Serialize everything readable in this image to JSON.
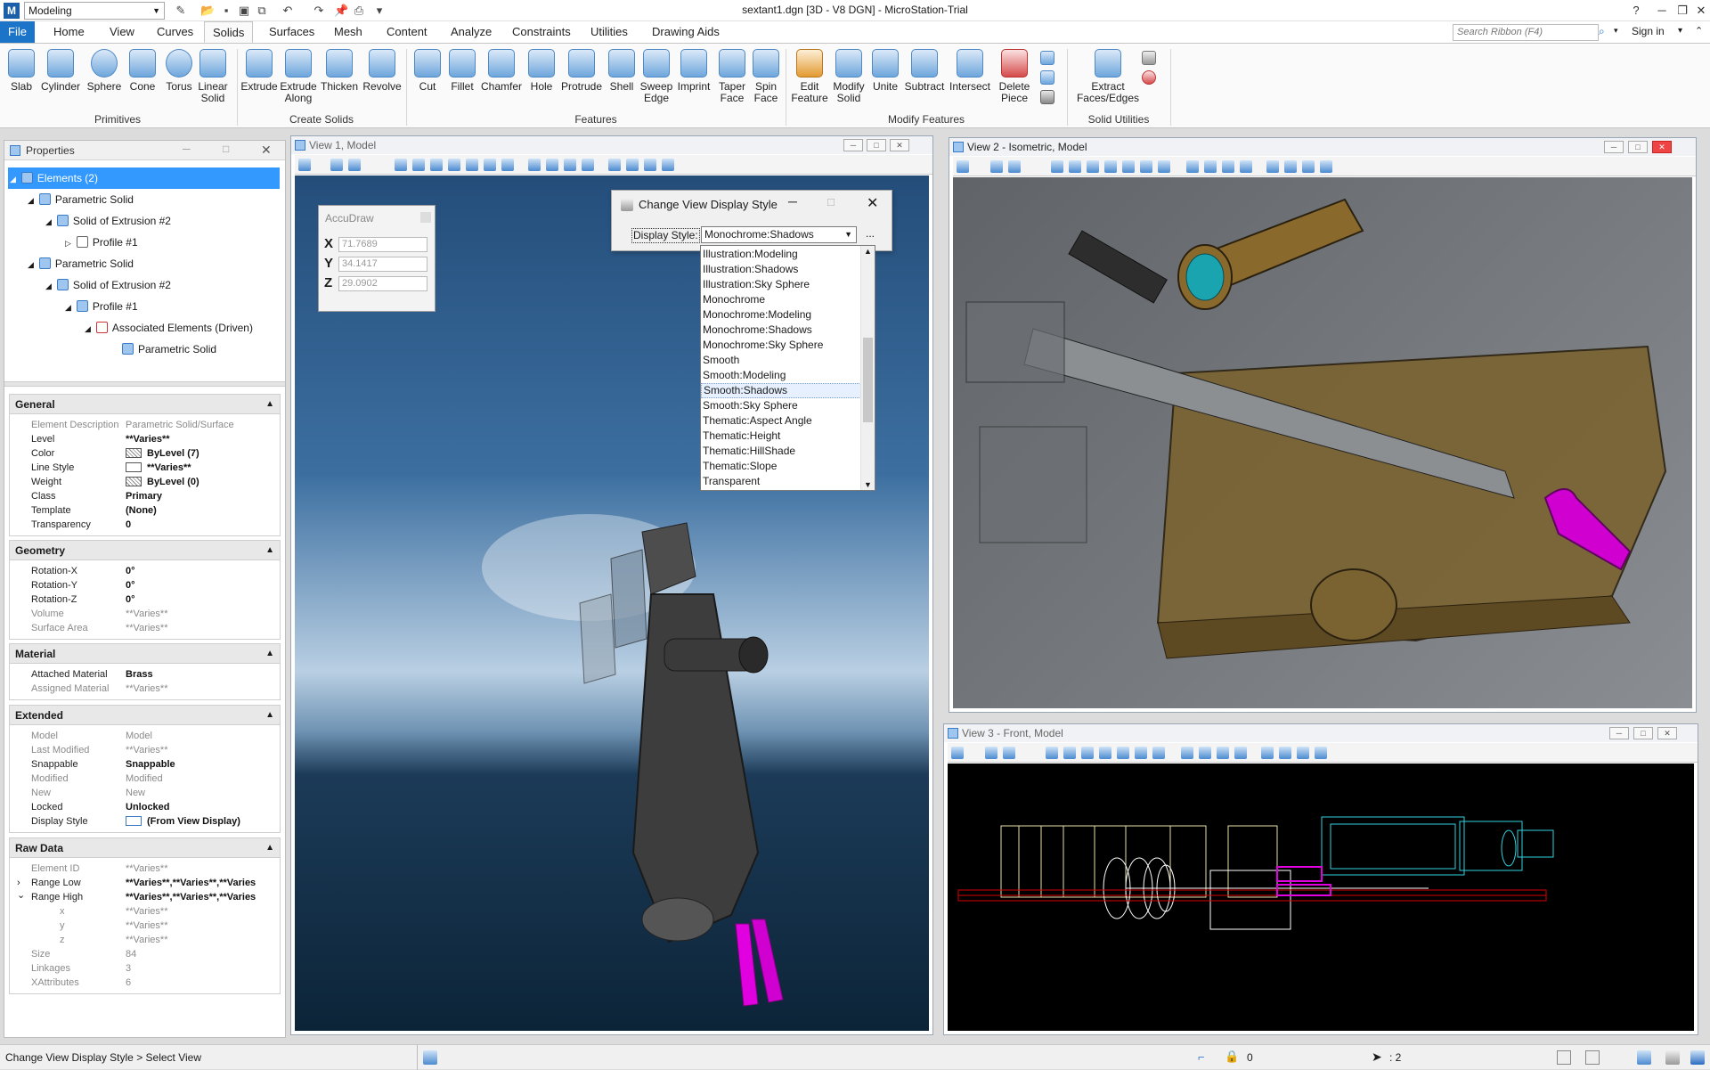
{
  "app": {
    "workflow": "Modeling",
    "window_title": "sextant1.dgn [3D - V8 DGN] - MicroStation-Trial",
    "search_placeholder": "Search Ribbon (F4)",
    "sign_in": "Sign in"
  },
  "tabs": [
    "File",
    "Home",
    "View",
    "Curves",
    "Solids",
    "Surfaces",
    "Mesh",
    "Content",
    "Analyze",
    "Constraints",
    "Utilities",
    "Drawing Aids"
  ],
  "active_tab": "Solids",
  "ribbon": {
    "groups": [
      {
        "label": "Primitives",
        "buttons": [
          "Slab",
          "Cylinder",
          "Sphere",
          "Cone",
          "Torus",
          "Linear Solid"
        ]
      },
      {
        "label": "Create Solids",
        "buttons": [
          "Extrude",
          "Extrude Along",
          "Thicken",
          "Revolve"
        ]
      },
      {
        "label": "Features",
        "buttons": [
          "Cut",
          "Fillet",
          "Chamfer",
          "Hole",
          "Protrude",
          "Shell",
          "Sweep Edge",
          "Imprint",
          "Taper Face",
          "Spin Face"
        ]
      },
      {
        "label": "Modify Features",
        "buttons": [
          "Edit Feature",
          "Modify Solid",
          "Unite",
          "Subtract",
          "Intersect",
          "Delete Piece"
        ]
      },
      {
        "label": "Solid Utilities",
        "buttons": [
          "Extract Faces/Edges"
        ]
      }
    ]
  },
  "properties": {
    "title": "Properties",
    "tree": [
      {
        "label": "Elements (2)",
        "depth": 0,
        "selected": true
      },
      {
        "label": "Parametric Solid",
        "depth": 1
      },
      {
        "label": "Solid of Extrusion #2",
        "depth": 2
      },
      {
        "label": "Profile #1",
        "depth": 3
      },
      {
        "label": "Parametric Solid",
        "depth": 1
      },
      {
        "label": "Solid of Extrusion #2",
        "depth": 2
      },
      {
        "label": "Profile #1",
        "depth": 3
      },
      {
        "label": "Associated Elements (Driven)",
        "depth": 4
      },
      {
        "label": "Parametric Solid",
        "depth": 5
      }
    ],
    "sections": [
      {
        "title": "General",
        "rows": [
          {
            "k": "Element Description",
            "v": "Parametric Solid/Surface",
            "dim": true
          },
          {
            "k": "Level",
            "v": "**Varies**"
          },
          {
            "k": "Color",
            "v": "ByLevel (7)"
          },
          {
            "k": "Line Style",
            "v": "**Varies**"
          },
          {
            "k": "Weight",
            "v": "ByLevel (0)"
          },
          {
            "k": "Class",
            "v": "Primary"
          },
          {
            "k": "Template",
            "v": "(None)"
          },
          {
            "k": "Transparency",
            "v": "0"
          }
        ]
      },
      {
        "title": "Geometry",
        "rows": [
          {
            "k": "Rotation-X",
            "v": "0°"
          },
          {
            "k": "Rotation-Y",
            "v": "0°"
          },
          {
            "k": "Rotation-Z",
            "v": "0°"
          },
          {
            "k": "Volume",
            "v": "**Varies**",
            "dim": true
          },
          {
            "k": "Surface Area",
            "v": "**Varies**",
            "dim": true
          }
        ]
      },
      {
        "title": "Material",
        "rows": [
          {
            "k": "Attached Material",
            "v": "Brass"
          },
          {
            "k": "Assigned Material",
            "v": "**Varies**",
            "dim": true
          }
        ]
      },
      {
        "title": "Extended",
        "rows": [
          {
            "k": "Model",
            "v": "Model",
            "dim": true
          },
          {
            "k": "Last Modified",
            "v": "**Varies**",
            "dim": true
          },
          {
            "k": "Snappable",
            "v": "Snappable"
          },
          {
            "k": "Modified",
            "v": "Modified",
            "dim": true
          },
          {
            "k": "New",
            "v": "New",
            "dim": true
          },
          {
            "k": "Locked",
            "v": "Unlocked"
          },
          {
            "k": "Display Style",
            "v": "(From View Display)"
          }
        ]
      },
      {
        "title": "Raw Data",
        "rows": [
          {
            "k": "Element ID",
            "v": "**Varies**",
            "dim": true
          },
          {
            "k": "Range Low",
            "v": "**Varies**,**Varies**,**Varies",
            "caret": "›"
          },
          {
            "k": "Range High",
            "v": "**Varies**,**Varies**,**Varies",
            "caret": "⌄"
          },
          {
            "k": "x",
            "v": "**Varies**",
            "dim": true,
            "indent": true
          },
          {
            "k": "y",
            "v": "**Varies**",
            "dim": true,
            "indent": true
          },
          {
            "k": "z",
            "v": "**Varies**",
            "dim": true,
            "indent": true
          },
          {
            "k": "Size",
            "v": "84",
            "dim": true
          },
          {
            "k": "Linkages",
            "v": "3",
            "dim": true
          },
          {
            "k": "XAttributes",
            "v": "6",
            "dim": true
          }
        ]
      }
    ]
  },
  "views": {
    "v1": "View 1, Model",
    "v2": "View 2 - Isometric, Model",
    "v3": "View 3 - Front, Model"
  },
  "accudraw": {
    "title": "AccuDraw",
    "x_label": "X",
    "x": "71.7689",
    "y_label": "Y",
    "y": "34.1417",
    "z_label": "Z",
    "z": "29.0902"
  },
  "display_style_dialog": {
    "title": "Change View Display Style",
    "label": "Display Style:",
    "selected": "Monochrome:Shadows",
    "more": "...",
    "options": [
      "Illustration:Modeling",
      "Illustration:Shadows",
      "Illustration:Sky Sphere",
      "Monochrome",
      "Monochrome:Modeling",
      "Monochrome:Shadows",
      "Monochrome:Sky Sphere",
      "Smooth",
      "Smooth:Modeling",
      "Smooth:Shadows",
      "Smooth:Sky Sphere",
      "Thematic:Aspect Angle",
      "Thematic:Height",
      "Thematic:HillShade",
      "Thematic:Slope",
      "Transparent"
    ],
    "highlighted": "Smooth:Shadows"
  },
  "status": {
    "prompt": "Change View Display Style > Select View",
    "lock_value": "0",
    "cursor_value": ": 2"
  },
  "colors": {
    "accent": "#1b74c8",
    "selection": "#3399ff",
    "brass": "#8a6a2c",
    "magenta": "#e000e0",
    "cyan": "#27c4d8"
  }
}
